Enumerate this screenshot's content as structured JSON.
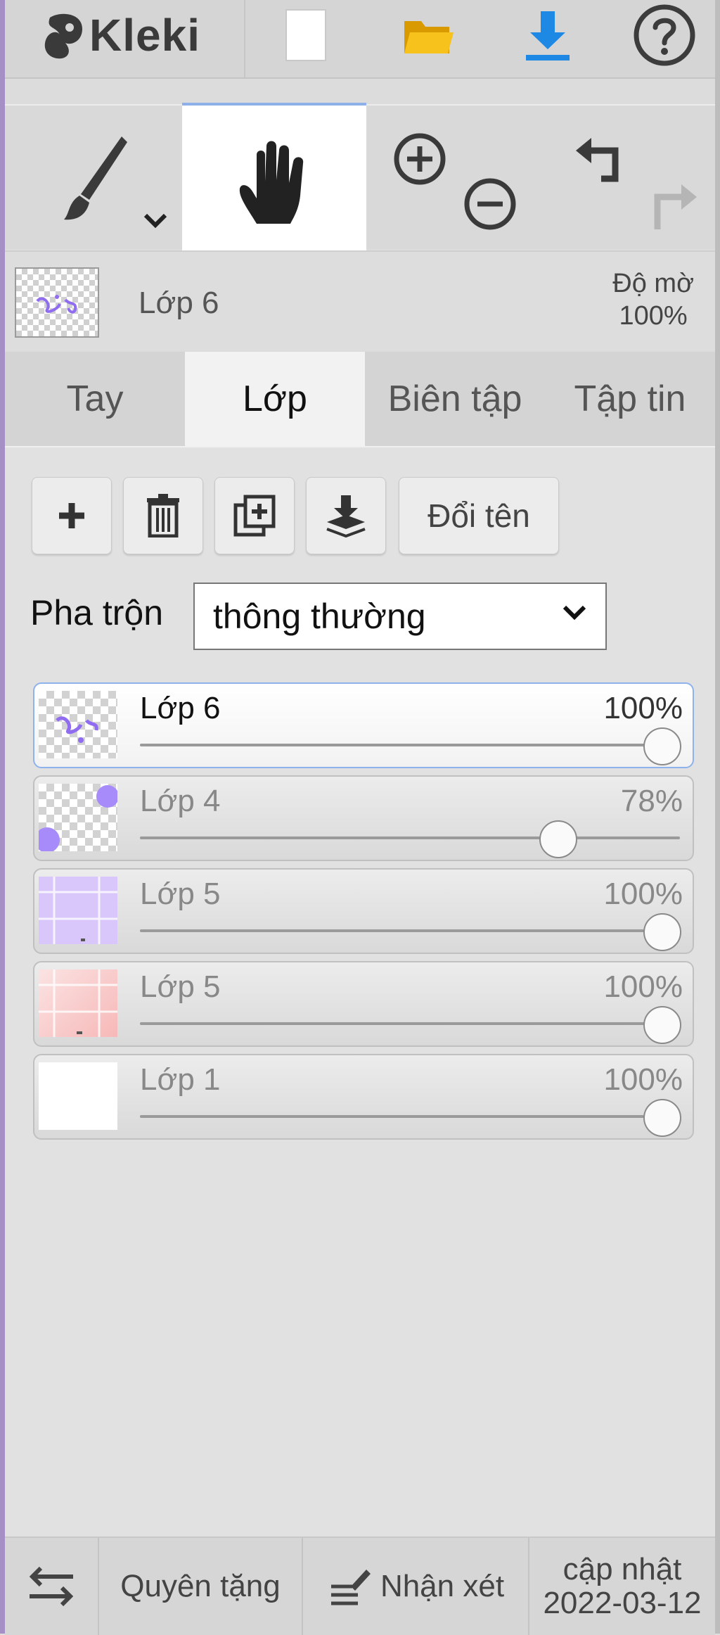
{
  "app": {
    "logo_text": "Kleki"
  },
  "toolbar": {
    "icons": [
      "new-image-icon",
      "open-folder-icon",
      "download-icon",
      "help-icon"
    ]
  },
  "tools": {
    "brush_icon": "brush-icon",
    "hand_icon": "hand-icon",
    "active": "hand",
    "zoom_icons": [
      "zoom-in-icon",
      "zoom-out-icon"
    ],
    "history_icons": [
      "undo-icon",
      "redo-icon"
    ]
  },
  "current_layer": {
    "name": "Lớp 6",
    "opacity_label": "Độ mờ",
    "opacity_value": "100%"
  },
  "tabs": [
    {
      "label": "Tay"
    },
    {
      "label": "Lớp",
      "active": true
    },
    {
      "label": "Biên tập"
    },
    {
      "label": "Tập tin"
    }
  ],
  "layer_actions": {
    "icons": [
      "add-layer-icon",
      "delete-layer-icon",
      "duplicate-layer-icon",
      "merge-down-icon"
    ],
    "rename_label": "Đổi tên"
  },
  "blend": {
    "label": "Pha trộn",
    "value": "thông thường"
  },
  "layers": [
    {
      "name": "Lớp 6",
      "opacity": "100%",
      "opacity_fraction": 1.0,
      "selected": true
    },
    {
      "name": "Lớp 4",
      "opacity": "78%",
      "opacity_fraction": 0.78
    },
    {
      "name": "Lớp 5",
      "opacity": "100%",
      "opacity_fraction": 1.0
    },
    {
      "name": "Lớp 5",
      "opacity": "100%",
      "opacity_fraction": 1.0
    },
    {
      "name": "Lớp 1",
      "opacity": "100%",
      "opacity_fraction": 1.0
    }
  ],
  "footer": {
    "swap_icon": "swap-icon",
    "donate_label": "Quyên tặng",
    "feedback_icon": "feedback-icon",
    "feedback_label": "Nhận xét",
    "update_label": "cập nhật",
    "update_date": "2022-03-12"
  },
  "colors": {
    "accent": "#1e88e5",
    "folder": "#f2b705",
    "selected_border": "#8eb2ec",
    "purple": "#a78bfa"
  }
}
